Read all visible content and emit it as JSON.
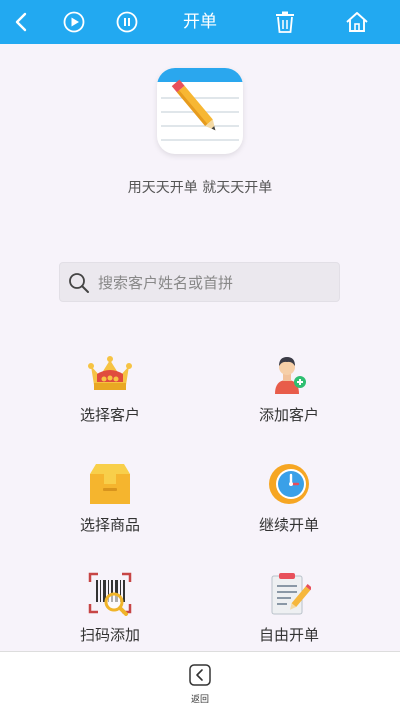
{
  "header": {
    "title": "开单",
    "icons": [
      "back-icon",
      "play-icon",
      "pause-icon",
      "trash-icon",
      "home-icon"
    ],
    "background": "#22a9f1"
  },
  "slogan": "用天天开单 就天天开单",
  "search": {
    "placeholder": "搜索客户姓名或首拼",
    "value": ""
  },
  "actions": [
    {
      "label": "选择客户",
      "icon": "crown-icon"
    },
    {
      "label": "添加客户",
      "icon": "add-person-icon"
    },
    {
      "label": "选择商品",
      "icon": "box-icon"
    },
    {
      "label": "继续开单",
      "icon": "clock-icon"
    },
    {
      "label": "扫码添加",
      "icon": "barcode-scan-icon"
    },
    {
      "label": "自由开单",
      "icon": "notepad-pen-icon"
    }
  ],
  "footer": {
    "back_label": "返回"
  }
}
